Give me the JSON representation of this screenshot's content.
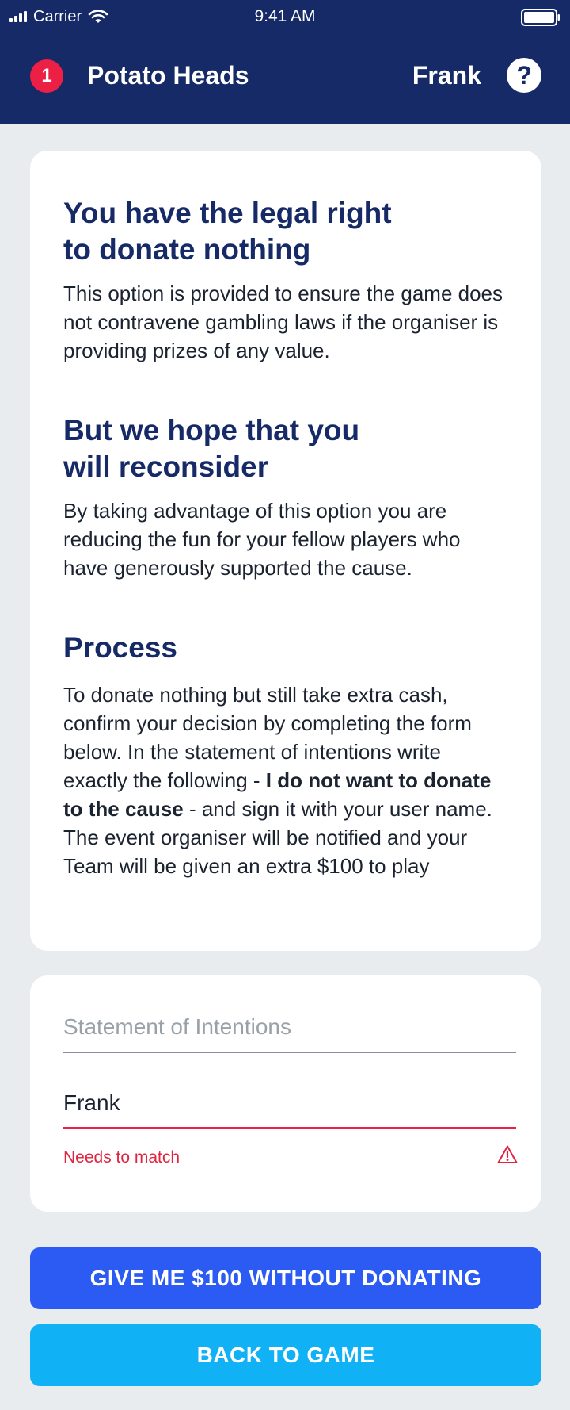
{
  "status_bar": {
    "carrier": "Carrier",
    "time": "9:41 AM",
    "icons": [
      "signal-icon",
      "wifi-icon",
      "battery-icon"
    ]
  },
  "app_bar": {
    "notification_count": "1",
    "team_name": "Potato Heads",
    "user_name": "Frank",
    "help_label": "?"
  },
  "info": {
    "section1": {
      "title": "You have the legal right to donate nothing",
      "title_line1": "You have the legal right",
      "title_line2": "to donate nothing",
      "body": "This option is provided to ensure the game does not contravene gambling laws if the organiser is providing prizes of any value."
    },
    "section2": {
      "title": "But we hope that you will reconsider",
      "title_line1": "But we hope that you",
      "title_line2": "will reconsider",
      "body": "By taking advantage of this option you are reducing the fun for your fellow players who have generously supported the cause."
    },
    "section3": {
      "title": "Process",
      "body_part1": "To donate nothing but still take extra cash, confirm your decision by completing the form below.  In the statement of intentions write exactly the following - ",
      "body_bold": "I do not want to donate to the cause",
      "body_part2": " - and sign it with your user name.  The event organiser will be notified and your Team will be given an extra $100 to play"
    }
  },
  "form": {
    "statement_placeholder": "Statement of Intentions",
    "statement_value": "",
    "signature_value": "Frank",
    "error_message": "Needs to match"
  },
  "buttons": {
    "primary": "GIVE ME $100 WITHOUT DONATING",
    "secondary": "BACK TO GAME"
  },
  "colors": {
    "header_bg": "#152a66",
    "heading": "#152a66",
    "badge": "#ec1f45",
    "error": "#e0243f",
    "primary_button": "#2b5bf3",
    "secondary_button": "#10b2f5",
    "page_bg": "#e9ecee"
  }
}
